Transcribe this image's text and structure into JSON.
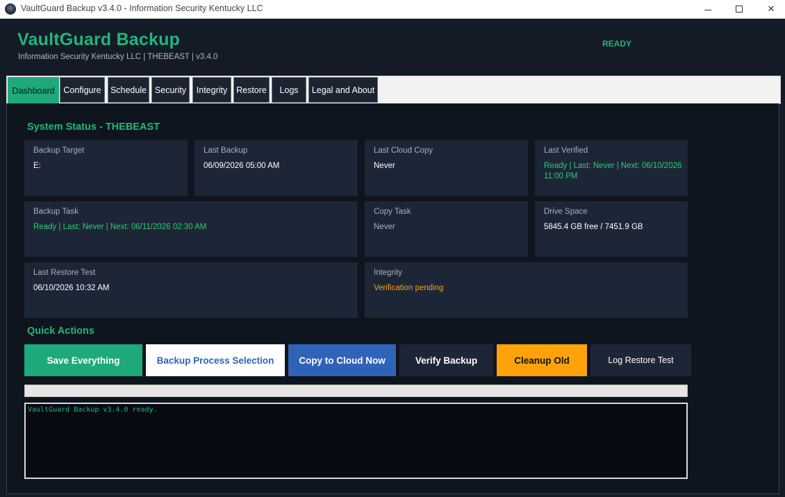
{
  "window": {
    "title": "VaultGuard Backup v3.4.0  -  Information Security Kentucky LLC",
    "icon": "vault-app-icon",
    "controls": {
      "minimize": "minimize-icon",
      "maximize": "maximize-icon",
      "close": "✕"
    }
  },
  "header": {
    "brand": "VaultGuard Backup",
    "subtitle": "Information Security Kentucky LLC  |  THEBEAST  |  v3.4.0",
    "status": "READY",
    "status_color": "#21b57d"
  },
  "tabs": [
    {
      "label": "Dashboard",
      "active": true
    },
    {
      "label": "Configure",
      "active": false
    },
    {
      "label": "Schedule",
      "active": false
    },
    {
      "label": "Security",
      "active": false
    },
    {
      "label": "Integrity",
      "active": false
    },
    {
      "label": "Restore",
      "active": false
    },
    {
      "label": "Logs",
      "active": false
    },
    {
      "label": "Legal and About",
      "active": false
    }
  ],
  "dashboard": {
    "system_status_title": "System Status  -  THEBEAST",
    "cards": {
      "backup_target": {
        "label": "Backup Target",
        "value": "E:"
      },
      "last_backup": {
        "label": "Last Backup",
        "value": "06/09/2026 05:00 AM"
      },
      "last_cloud_copy": {
        "label": "Last Cloud Copy",
        "value": "Never"
      },
      "last_verified": {
        "label": "Last Verified",
        "value": "Ready | Last: Never | Next: 06/10/2026 11:00 PM"
      },
      "backup_task": {
        "label": "Backup Task",
        "value": "Ready | Last: Never | Next: 06/11/2026 02:30 AM"
      },
      "copy_task": {
        "label": "Copy Task",
        "value": "Never"
      },
      "drive_space": {
        "label": "Drive Space",
        "value": "5845.4 GB free / 7451.9 GB"
      },
      "last_restore_test": {
        "label": "Last Restore Test",
        "value": "06/10/2026 10:32 AM"
      },
      "integrity": {
        "label": "Integrity",
        "value": "Verification pending"
      }
    },
    "quick_actions_title": "Quick Actions",
    "buttons": {
      "save_everything": "Save Everything",
      "backup_process_selection": "Backup Process Selection",
      "copy_to_cloud": "Copy to Cloud Now",
      "verify_backup": "Verify Backup",
      "cleanup_old": "Cleanup Old",
      "log_restore_test": "Log Restore Test"
    },
    "progress": 0,
    "console_text": "VaultGuard Backup v3.4.0 ready."
  },
  "colors": {
    "accent_green": "#21b57d",
    "status_ok": "#2ecc71",
    "status_warn": "#f2a31b",
    "primary_blue": "#2f63b8",
    "warning_orange": "#fea20a",
    "card_bg": "#1d2637",
    "panel_bg": "#0f151e"
  }
}
